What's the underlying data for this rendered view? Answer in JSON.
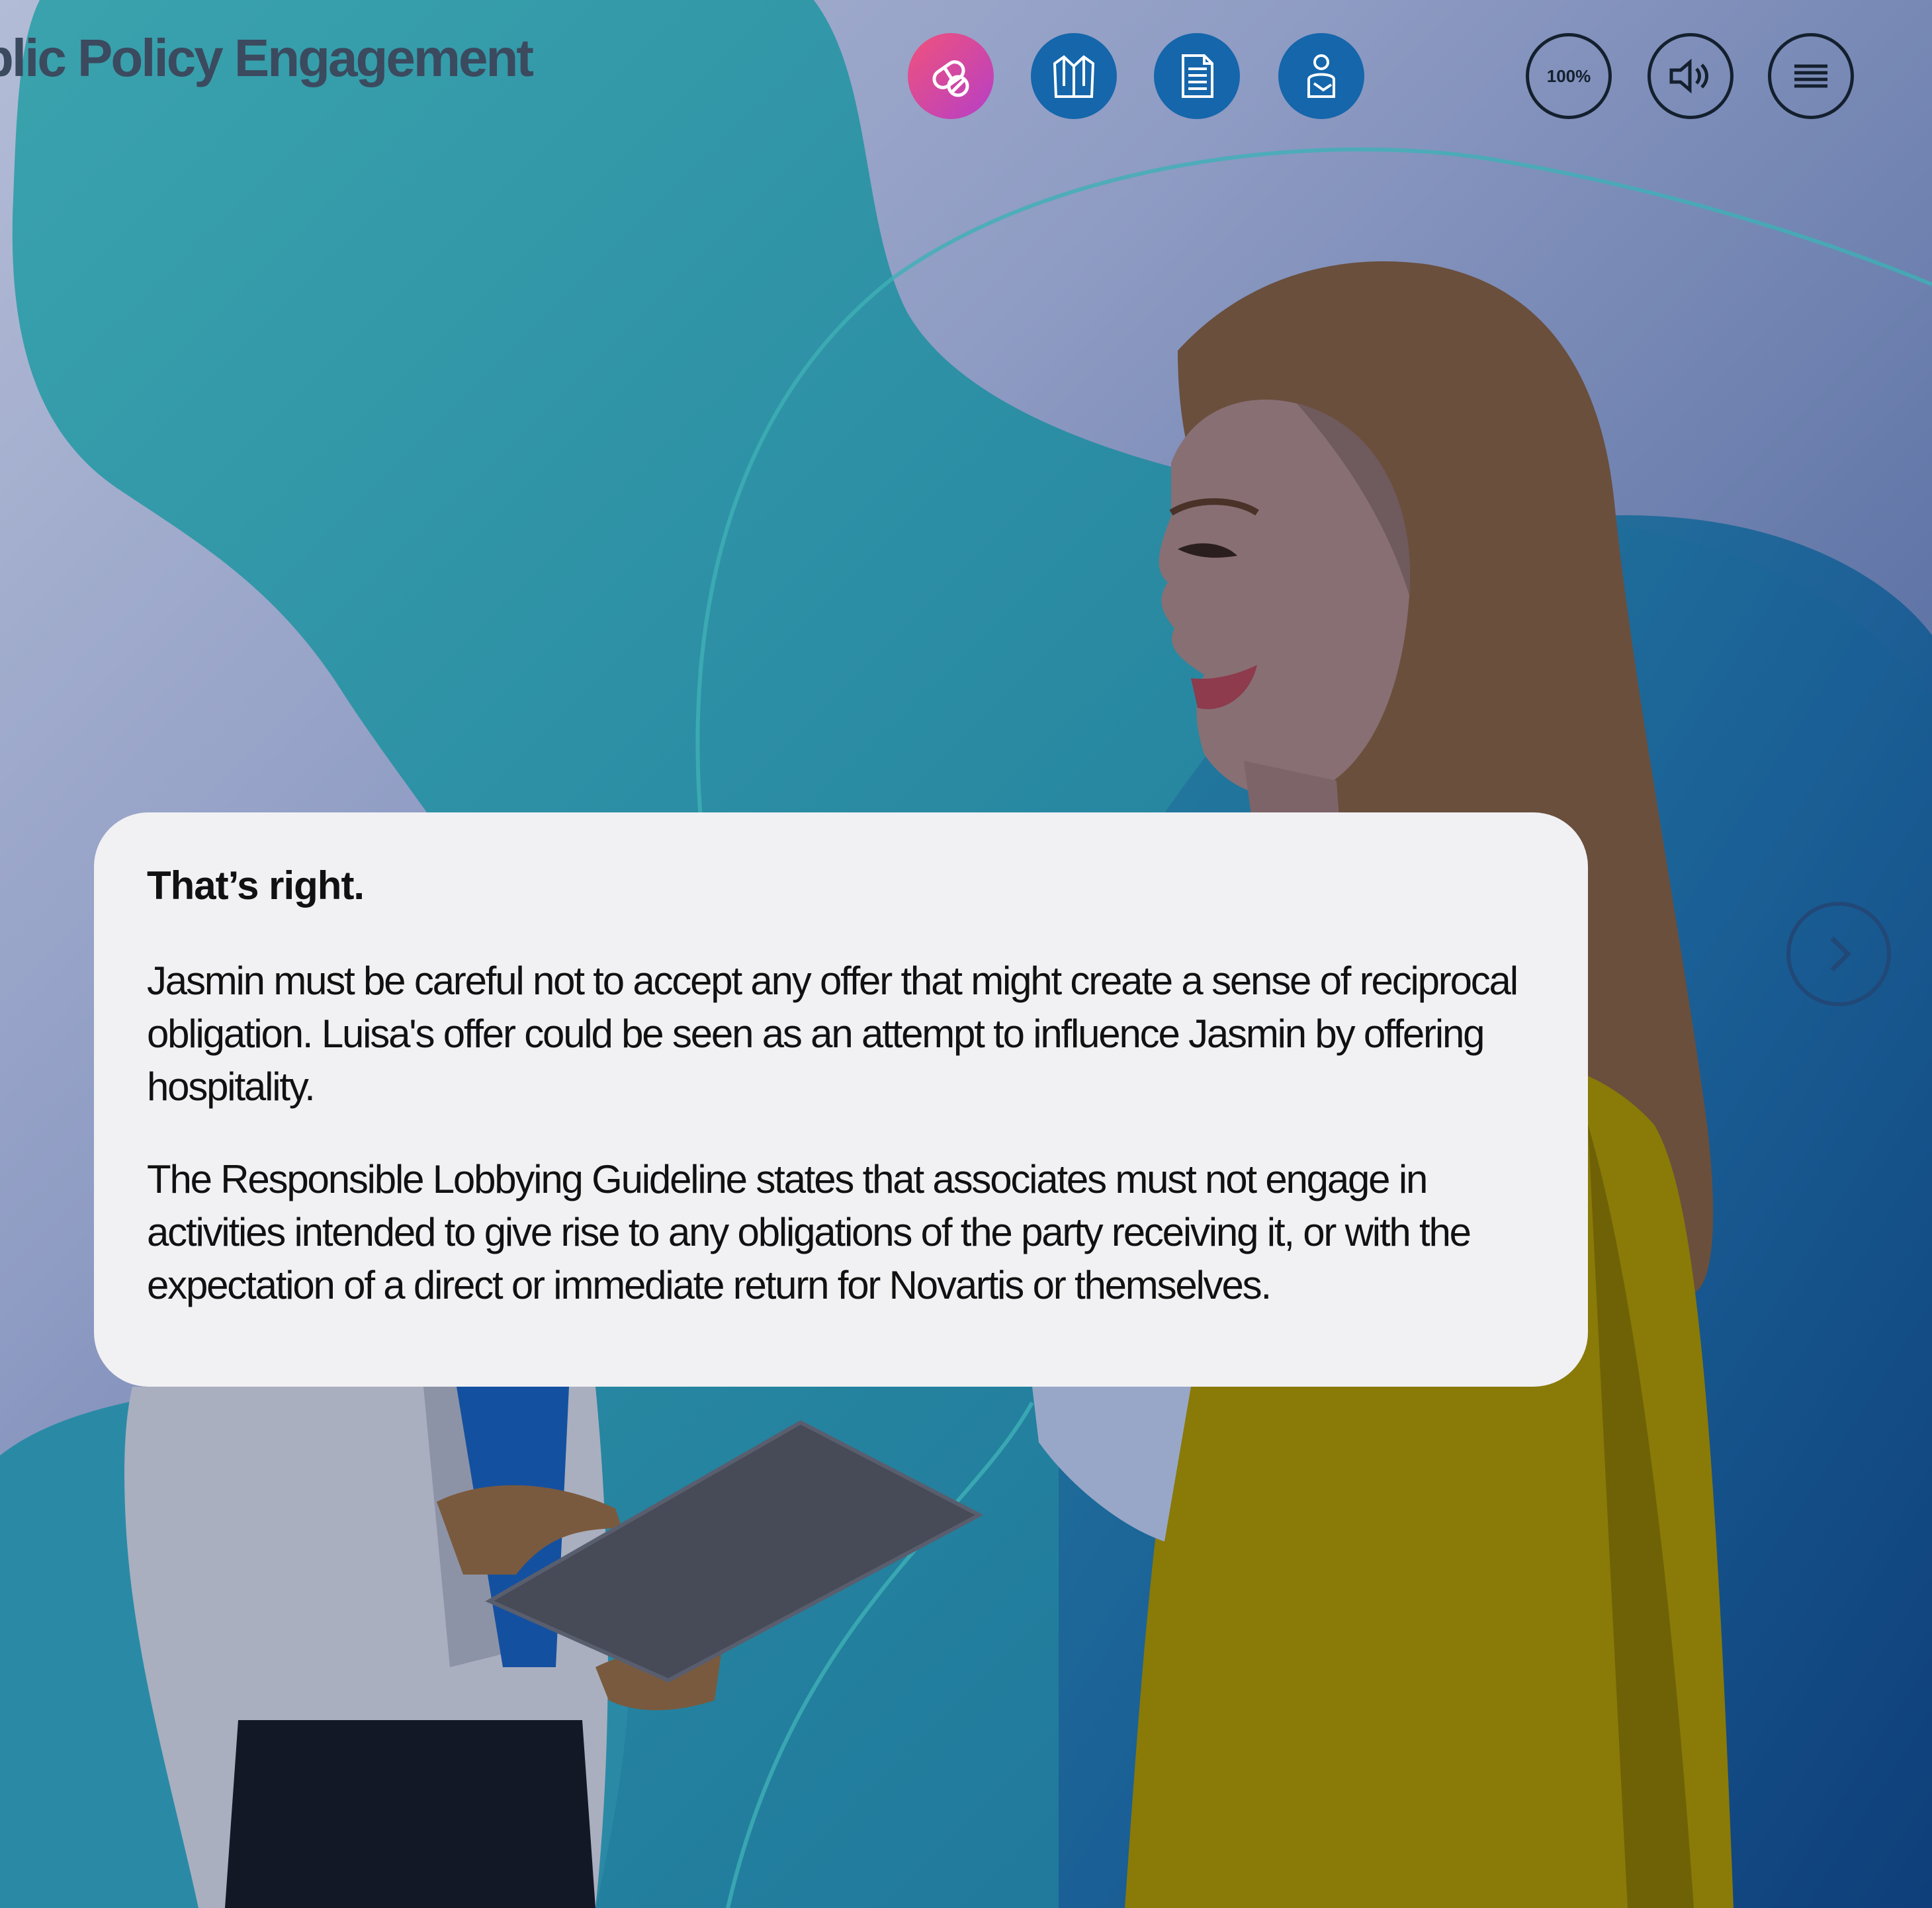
{
  "header": {
    "course_title": "blic Policy Engagement",
    "tools": [
      {
        "icon": "pills-icon",
        "color": "#d044b8"
      },
      {
        "icon": "lab-coat-icon",
        "color": "#1566ab"
      },
      {
        "icon": "document-icon",
        "color": "#1566ab"
      },
      {
        "icon": "patient-icon",
        "color": "#1566ab"
      }
    ],
    "zoom_label": "100%",
    "audio_icon": "speaker-icon",
    "menu_icon": "hamburger-menu-icon"
  },
  "feedback": {
    "heading": "That’s right.",
    "paragraph_1": "Jasmin must be careful not to accept any offer that might create a sense of reciprocal obligation. Luisa's offer could be seen as an attempt to influence Jasmin by offering hospitality.",
    "paragraph_2": "The Responsible Lobbying Guideline states that associates must not engage in activities intended to give rise to any obligations of the party receiving it, or with the expectation of a direct or immediate return for Novartis or themselves."
  },
  "navigation": {
    "next_icon": "chevron-right-icon"
  },
  "colors": {
    "teal_blob": "#2b8fa6",
    "dark_blob": "#1a5f96",
    "jacket_yellow": "#8a7a08",
    "icon_blue": "#1566ab",
    "icon_pink": "#d044b8",
    "card_background": "#f1f1f3"
  }
}
